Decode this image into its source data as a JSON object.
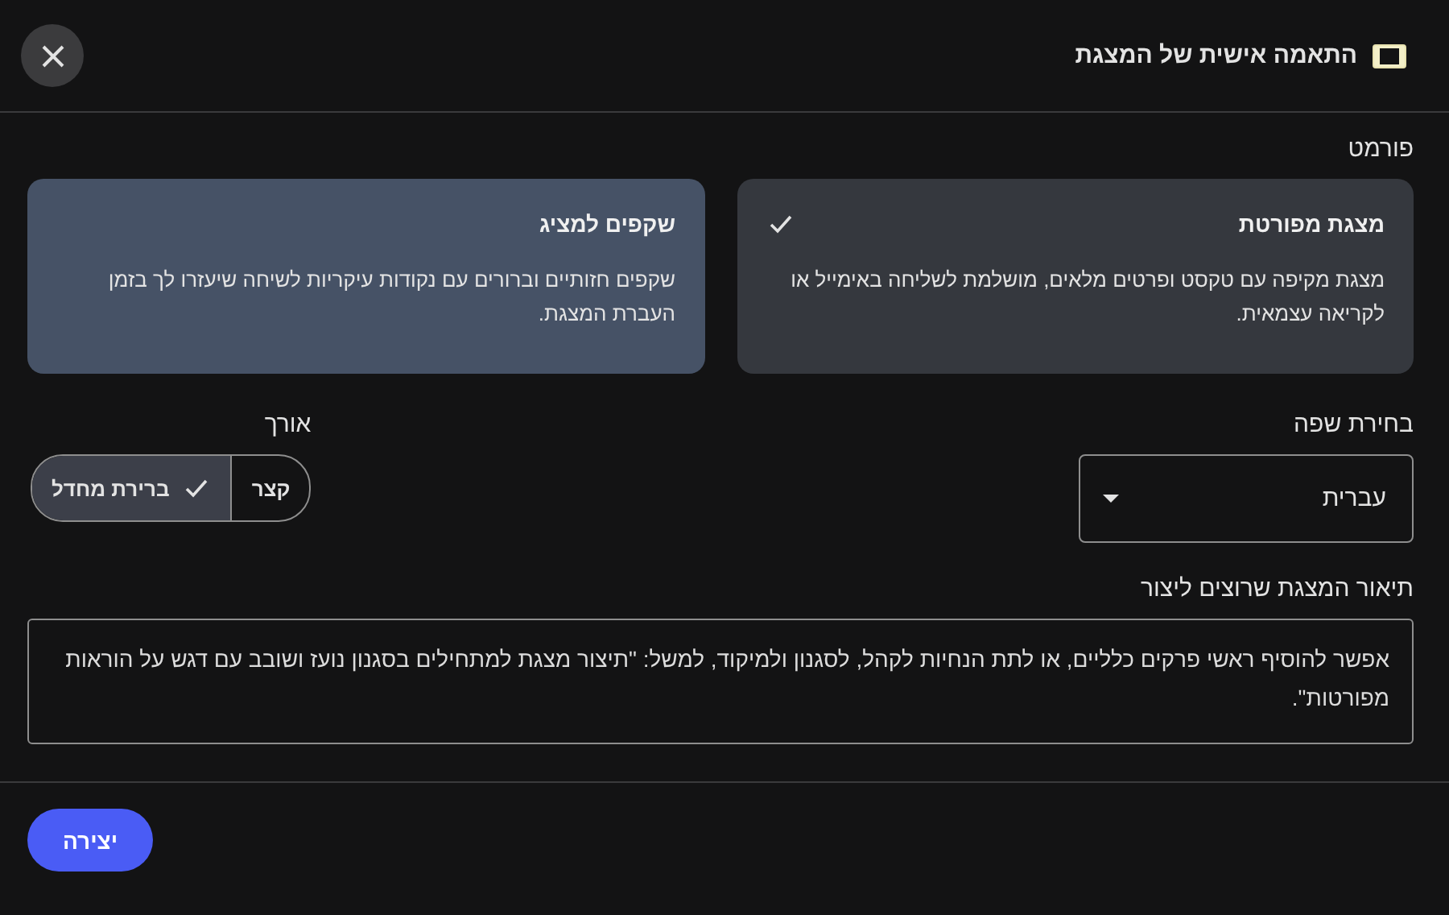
{
  "dialog": {
    "title": "התאמה אישית של המצגת"
  },
  "format": {
    "label": "פורמט",
    "options": [
      {
        "title": "מצגת מפורטת",
        "description": "מצגת מקיפה עם טקסט ופרטים מלאים, מושלמת לשליחה באימייל או לקריאה עצמאית.",
        "selected": true
      },
      {
        "title": "שקפים למציג",
        "description": "שקפים חזותיים וברורים עם נקודות עיקריות לשיחה שיעזרו לך בזמן העברת המצגת.",
        "selected": false
      }
    ]
  },
  "language": {
    "label": "בחירת שפה",
    "value": "עברית"
  },
  "length": {
    "label": "אורך",
    "options": [
      {
        "label": "קצר",
        "selected": false
      },
      {
        "label": "ברירת מחדל",
        "selected": true
      }
    ]
  },
  "description": {
    "label": "תיאור המצגת שרוצים ליצור",
    "placeholder": "אפשר להוסיף ראשי פרקים כלליים, או לתת הנחיות לקהל, לסגנון ולמיקוד, למשל: \"תיצור מצגת למתחילים בסגנון נועז ושובב עם דגש על הוראות מפורטות\"."
  },
  "footer": {
    "button": "יצירה"
  }
}
